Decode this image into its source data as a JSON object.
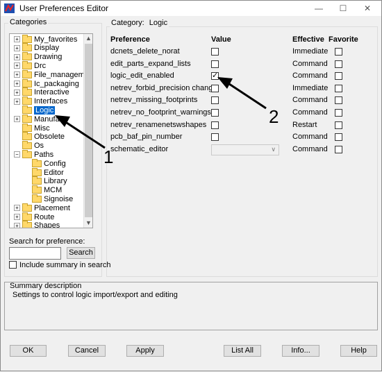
{
  "window": {
    "title": "User Preferences Editor",
    "min_label": "—",
    "max_label": "☐",
    "close_label": "✕"
  },
  "categories": {
    "label": "Categories",
    "items": [
      {
        "label": "My_favorites",
        "expand": "+"
      },
      {
        "label": "Display",
        "expand": "+"
      },
      {
        "label": "Drawing",
        "expand": "+"
      },
      {
        "label": "Drc",
        "expand": "+"
      },
      {
        "label": "File_management",
        "expand": "+"
      },
      {
        "label": "Ic_packaging",
        "expand": "+"
      },
      {
        "label": "Interactive",
        "expand": "+"
      },
      {
        "label": "Interfaces",
        "expand": "+"
      },
      {
        "label": "Logic",
        "expand": "",
        "selected": true
      },
      {
        "label": "Manufac",
        "expand": "+"
      },
      {
        "label": "Misc",
        "expand": ""
      },
      {
        "label": "Obsolete",
        "expand": ""
      },
      {
        "label": "Os",
        "expand": ""
      },
      {
        "label": "Paths",
        "expand": "−"
      },
      {
        "label": "Config",
        "expand": "",
        "child": true
      },
      {
        "label": "Editor",
        "expand": "",
        "child": true
      },
      {
        "label": "Library",
        "expand": "",
        "child": true
      },
      {
        "label": "MCM",
        "expand": "",
        "child": true
      },
      {
        "label": "Signoise",
        "expand": "",
        "child": true
      },
      {
        "label": "Placement",
        "expand": "+"
      },
      {
        "label": "Route",
        "expand": "+"
      },
      {
        "label": "Shapes",
        "expand": "+"
      }
    ]
  },
  "search": {
    "label": "Search for preference:",
    "value": "",
    "button": "Search",
    "include_summary_label": "Include summary in search",
    "include_summary_checked": false
  },
  "category_panel": {
    "label_prefix": "Category:",
    "label_value": "Logic",
    "col_preference": "Preference",
    "col_value": "Value",
    "col_effective": "Effective",
    "col_favorite": "Favorite",
    "rows": [
      {
        "name": "dcnets_delete_norat",
        "checked": false,
        "effective": "Immediate",
        "favorite": false
      },
      {
        "name": "edit_parts_expand_lists",
        "checked": false,
        "effective": "Command",
        "favorite": false
      },
      {
        "name": "logic_edit_enabled",
        "checked": true,
        "effective": "Command",
        "favorite": false
      },
      {
        "name": "netrev_forbid_precision change",
        "checked": false,
        "effective": "Immediate",
        "favorite": false
      },
      {
        "name": "netrev_missing_footprints",
        "checked": false,
        "effective": "Command",
        "favorite": false
      },
      {
        "name": "netrev_no_footprint_warnings",
        "checked": false,
        "effective": "Command",
        "favorite": false
      },
      {
        "name": "netrev_renamenetswshapes",
        "checked": false,
        "effective": "Restart",
        "favorite": false
      },
      {
        "name": "pcb_baf_pin_number",
        "checked": false,
        "effective": "Command",
        "favorite": false
      },
      {
        "name": "schematic_editor",
        "dropdown": true,
        "value": "",
        "effective": "Command",
        "favorite": false
      }
    ]
  },
  "summary": {
    "label": "Summary description",
    "text": "Settings to control logic import/export and editing"
  },
  "buttons": {
    "ok": "OK",
    "cancel": "Cancel",
    "apply": "Apply",
    "list_all": "List All",
    "info": "Info...",
    "help": "Help"
  },
  "annotations": [
    {
      "label": "1"
    },
    {
      "label": "2"
    }
  ],
  "colors": {
    "selection": "#0066cc",
    "folder": "#ffd86a"
  }
}
